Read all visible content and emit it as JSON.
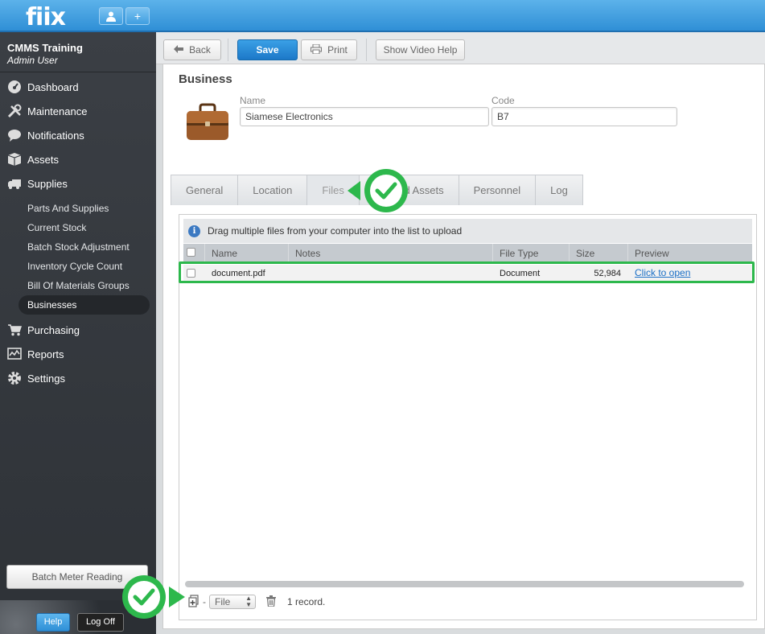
{
  "app": {
    "logo": "fiix",
    "top_buttons": [
      "user-icon",
      "plus-icon"
    ]
  },
  "sidebar": {
    "org_name": "CMMS Training",
    "user": "Admin User",
    "nav": [
      {
        "label": "Dashboard",
        "icon": "dashboard-icon"
      },
      {
        "label": "Maintenance",
        "icon": "tools-icon"
      },
      {
        "label": "Notifications",
        "icon": "chat-bubble-icon"
      },
      {
        "label": "Assets",
        "icon": "box-icon"
      },
      {
        "label": "Supplies",
        "icon": "truck-icon"
      }
    ],
    "sub": [
      "Parts And Supplies",
      "Current Stock",
      "Batch Stock Adjustment",
      "Inventory Cycle Count",
      "Bill Of Materials Groups",
      "Businesses"
    ],
    "nav2": [
      {
        "label": "Purchasing",
        "icon": "cart-icon"
      },
      {
        "label": "Reports",
        "icon": "chart-icon"
      },
      {
        "label": "Settings",
        "icon": "gear-icon"
      }
    ],
    "batch_meter": "Batch Meter Reading",
    "help": "Help",
    "logoff": "Log Off"
  },
  "toolbar": {
    "back": "Back",
    "save": "Save",
    "print": "Print",
    "video_help": "Show Video Help"
  },
  "business": {
    "title": "Business",
    "name_label": "Name",
    "name_value": "Siamese Electronics",
    "code_label": "Code",
    "code_value": "B7"
  },
  "tabs": [
    "General",
    "Location",
    "Files",
    "Related Assets",
    "Personnel",
    "Log"
  ],
  "active_tab": "Files",
  "files": {
    "info": "Drag multiple files from your computer into the list to upload",
    "columns": [
      "Name",
      "Notes",
      "File Type",
      "Size",
      "Preview"
    ],
    "rows": [
      {
        "name": "document.pdf",
        "notes": "",
        "type": "Document",
        "size": "52,984",
        "preview": "Click to open"
      }
    ],
    "file_select": "File",
    "record_count": "1 record."
  },
  "colors": {
    "accent": "#2f8fd6",
    "callout_green": "#2db84c",
    "sidebar": "#34383d"
  }
}
